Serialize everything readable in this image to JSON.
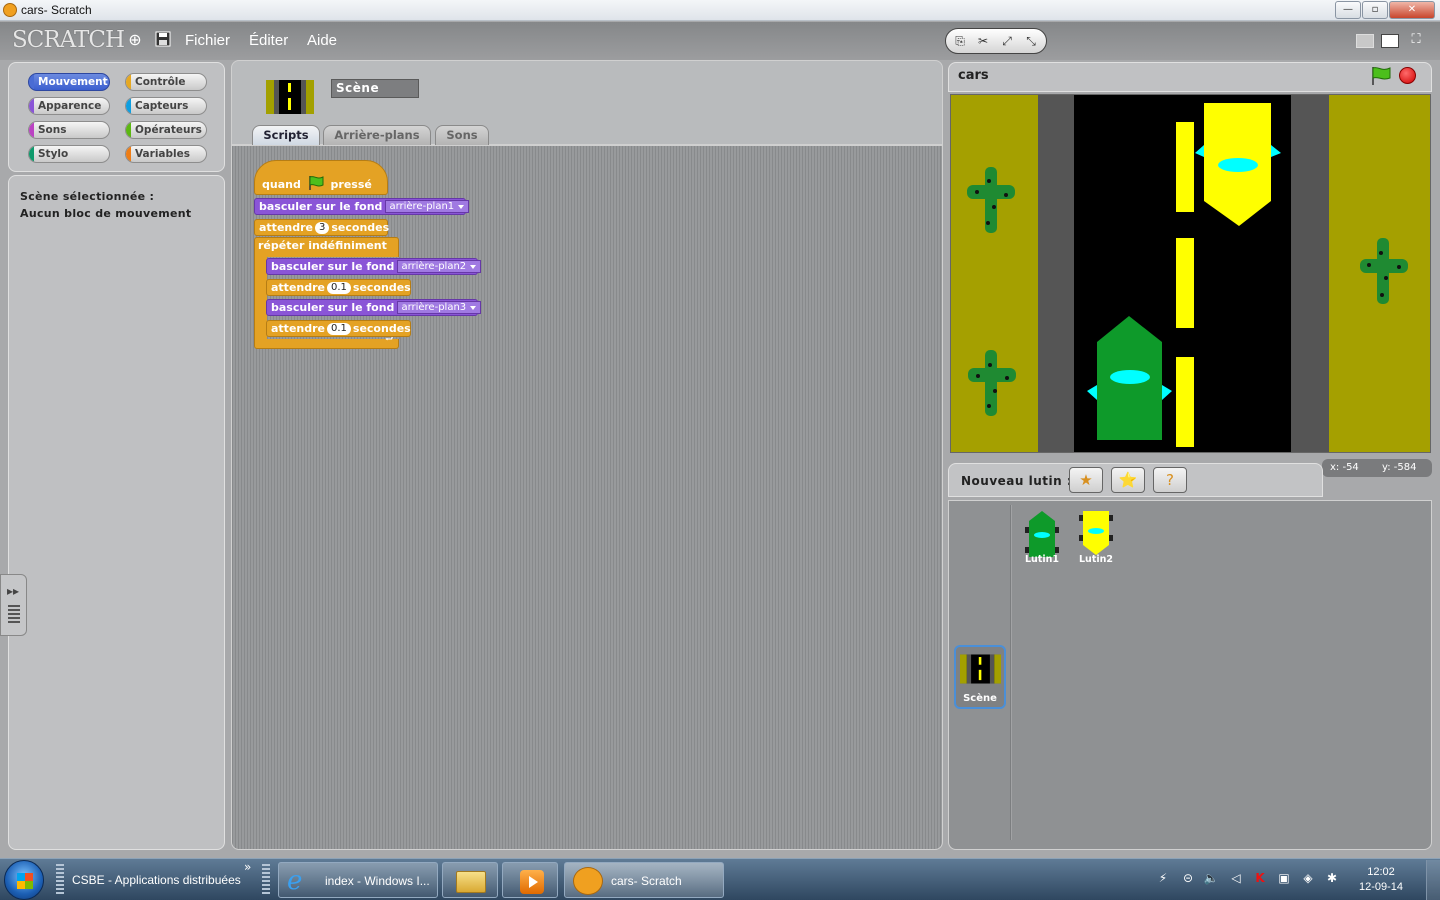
{
  "window": {
    "title": "cars- Scratch",
    "min_glyph": "—",
    "max_glyph": "▫",
    "close_glyph": "✕"
  },
  "menubar": {
    "logo": "SCRATCH",
    "items": [
      "Fichier",
      "Éditer",
      "Aide"
    ]
  },
  "categories": [
    {
      "label": "Mouvement",
      "color": "#4a6cd4",
      "selected": true
    },
    {
      "label": "Contrôle",
      "color": "#e6a822"
    },
    {
      "label": "Apparence",
      "color": "#8a55d7"
    },
    {
      "label": "Capteurs",
      "color": "#0e9ee0"
    },
    {
      "label": "Sons",
      "color": "#bb42c3"
    },
    {
      "label": "Opérateurs",
      "color": "#5cb712"
    },
    {
      "label": "Stylo",
      "color": "#0e9a6c"
    },
    {
      "label": "Variables",
      "color": "#ee7d16"
    }
  ],
  "palette_message": {
    "line1": "Scène sélectionnée :",
    "line2": "Aucun bloc de mouvement"
  },
  "scripts_panel": {
    "object_name": "Scène",
    "tabs": [
      "Scripts",
      "Arrière-plans",
      "Sons"
    ],
    "active_tab": "Scripts"
  },
  "script": {
    "hat": {
      "pre": "quand",
      "post": "pressé"
    },
    "b1": {
      "text": "basculer sur le fond",
      "value": "arrière-plan1"
    },
    "b2": {
      "pre": "attendre",
      "value": "3",
      "post": "secondes"
    },
    "loop": "répéter indéfiniment",
    "b3": {
      "text": "basculer sur le fond",
      "value": "arrière-plan2"
    },
    "b4": {
      "pre": "attendre",
      "value": "0.1",
      "post": "secondes"
    },
    "b5": {
      "text": "basculer sur le fond",
      "value": "arrière-plan3"
    },
    "b6": {
      "pre": "attendre",
      "value": "0.1",
      "post": "secondes"
    },
    "loop_end": "⮐"
  },
  "stage": {
    "title": "cars",
    "mouse_x": "x: -54",
    "mouse_y": "y: -584"
  },
  "new_sprite": {
    "label": "Nouveau lutin :"
  },
  "sprites": [
    {
      "name": "Lutin1"
    },
    {
      "name": "Lutin2"
    }
  ],
  "stage_thumb": {
    "name": "Scène"
  },
  "taskbar": {
    "toolbar_label": "CSBE - Applications distribuées",
    "more_glyph": "»",
    "items": [
      "index - Windows I...",
      "",
      "",
      "cars- Scratch"
    ],
    "time": "12:02",
    "date": "12-09-14"
  }
}
